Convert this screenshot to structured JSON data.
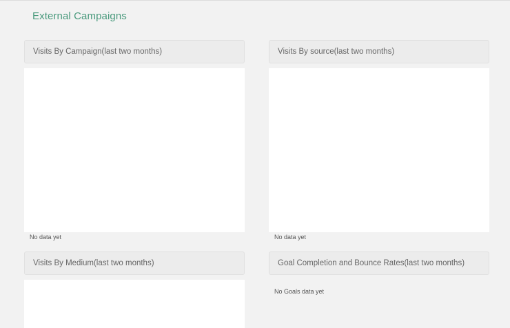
{
  "page": {
    "title": "External Campaigns"
  },
  "panels": [
    {
      "title": "Visits By Campaign(last two months)",
      "empty_text": "No data yet"
    },
    {
      "title": "Visits By source(last two months)",
      "empty_text": "No data yet"
    },
    {
      "title": "Visits By Medium(last two months)",
      "empty_text": ""
    },
    {
      "title": "Goal Completion and Bounce Rates(last two months)",
      "empty_text": "No Goals data yet"
    }
  ],
  "colors": {
    "accent": "#4a9a7d",
    "background": "#f2f2f2",
    "panel_header": "#ececec"
  }
}
